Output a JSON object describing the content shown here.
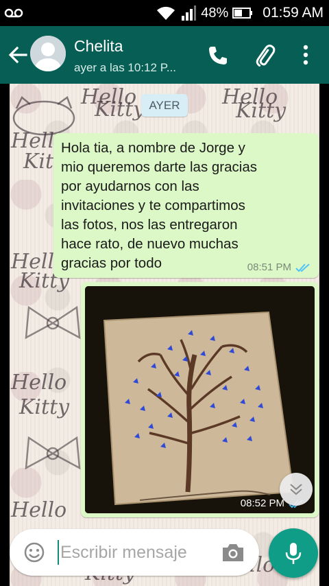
{
  "status_bar": {
    "battery_percent": "48%",
    "time": "01:59 AM",
    "icons": [
      "voicemail-icon",
      "wifi-icon",
      "signal-icon",
      "battery-icon"
    ]
  },
  "header": {
    "contact_name": "Chelita",
    "last_seen": "ayer a las 10:12 P...",
    "icons": [
      "back-arrow-icon",
      "avatar-placeholder-icon",
      "phone-icon",
      "paperclip-icon",
      "more-vert-icon"
    ],
    "bar_color": "#075e54"
  },
  "chat": {
    "date_divider": "AYER",
    "background_text": [
      "Hello",
      "Kitty"
    ],
    "messages": [
      {
        "type": "text",
        "text": "Hola tia,  a nombre de Jorge y\nmio queremos darte las gracias\npor ayudarnos con las\ninvitaciones y te compartimos\nlas fotos,  nos las entregaron\nhace rato,  de nuevo muchas\ngracias por todo",
        "time": "08:51 PM",
        "status": "read"
      },
      {
        "type": "image",
        "time": "08:52 PM",
        "status": "read",
        "image_description": "tree-with-blue-butterflies"
      }
    ],
    "bubble_color": "#dcf8c6",
    "read_tick_color": "#4fc3f7"
  },
  "composer": {
    "placeholder": "Escribir mensaje",
    "icons": [
      "emoji-icon",
      "camera-icon",
      "mic-icon",
      "chevron-down-icon"
    ],
    "send_button_color": "#0f9d88"
  }
}
